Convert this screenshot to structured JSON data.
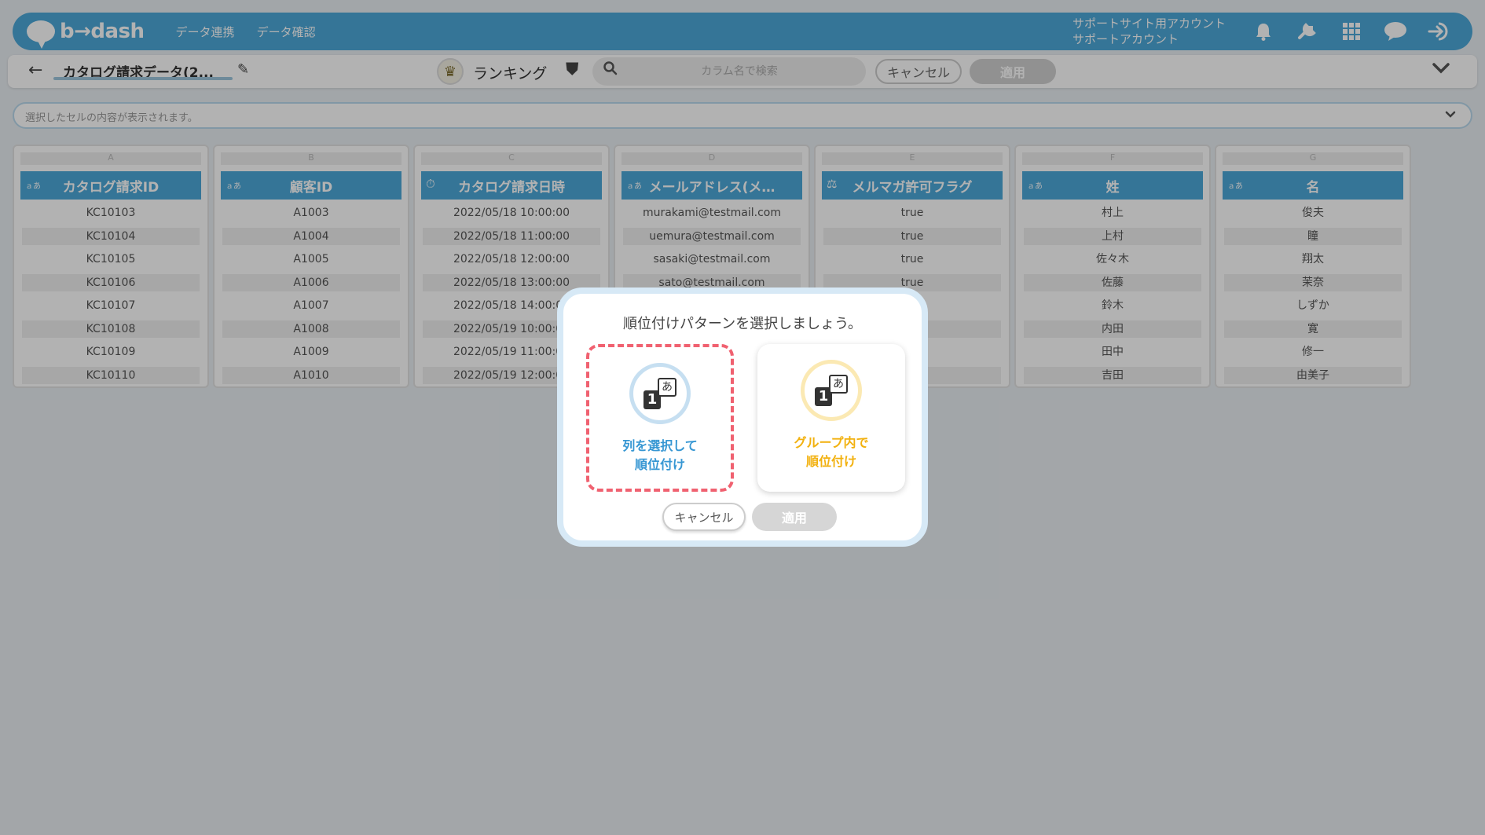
{
  "header": {
    "logo_text": "b→dash",
    "nav": [
      "データ連携",
      "データ確認"
    ],
    "account_line1": "サポートサイト用アカウント",
    "account_line2": "サポートアカウント",
    "icons": [
      "bell-icon",
      "wrench-icon",
      "grid-apps-icon",
      "chat-badge-icon",
      "logout-icon"
    ]
  },
  "toolbar": {
    "back_icon": "←",
    "table_title": "カタログ請求データ(2...",
    "edit_icon": "✎",
    "ranking_icon": "♛",
    "ranking_label": "ランキング",
    "shield_icon": "⛊",
    "search_placeholder": "カラム名で検索",
    "cancel_label": "キャンセル",
    "apply_label": "適用",
    "chevron": "⌄"
  },
  "cell_bar": {
    "placeholder": "選択したセルの内容が表示されます。",
    "chevron": "⌄"
  },
  "columns": [
    {
      "letter": "A",
      "type_icon": "ａあ",
      "header": "カタログ請求ID",
      "cells": [
        "KC10103",
        "KC10104",
        "KC10105",
        "KC10106",
        "KC10107",
        "KC10108",
        "KC10109",
        "KC10110"
      ]
    },
    {
      "letter": "B",
      "type_icon": "ａあ",
      "header": "顧客ID",
      "cells": [
        "A1003",
        "A1004",
        "A1005",
        "A1006",
        "A1007",
        "A1008",
        "A1009",
        "A1010"
      ]
    },
    {
      "letter": "C",
      "type_icon": "⏱",
      "header": "カタログ請求日時",
      "cells": [
        "2022/05/18 10:00:00",
        "2022/05/18 11:00:00",
        "2022/05/18 12:00:00",
        "2022/05/18 13:00:00",
        "2022/05/18 14:00:00",
        "2022/05/19 10:00:00",
        "2022/05/19 11:00:00",
        "2022/05/19 12:00:00"
      ]
    },
    {
      "letter": "D",
      "type_icon": "ａあ",
      "header": "メールアドレス(メ…",
      "cells": [
        "murakami@testmail.com",
        "uemura@testmail.com",
        "sasaki@testmail.com",
        "sato@testmail.com",
        "",
        "",
        "",
        ""
      ]
    },
    {
      "letter": "E",
      "type_icon": "⚖",
      "header": "メルマガ許可フラグ",
      "cells": [
        "true",
        "true",
        "true",
        "true",
        "",
        "",
        "",
        ""
      ]
    },
    {
      "letter": "F",
      "type_icon": "ａあ",
      "header": "姓",
      "cells": [
        "村上",
        "上村",
        "佐々木",
        "佐藤",
        "鈴木",
        "内田",
        "田中",
        "吉田"
      ]
    },
    {
      "letter": "G",
      "type_icon": "ａあ",
      "header": "名",
      "cells": [
        "俊夫",
        "瞳",
        "翔太",
        "茉奈",
        "しずか",
        "寛",
        "修一",
        "由美子"
      ]
    }
  ],
  "modal": {
    "title": "順位付けパターンを選択しましょう。",
    "option_glyph_number": "1",
    "option_glyph_kana": "あ",
    "option1_line1": "列を選択して",
    "option1_line2": "順位付け",
    "option2_line1": "グループ内で",
    "option2_line2": "順位付け",
    "cancel_label": "キャンセル",
    "apply_label": "適用"
  },
  "colors": {
    "brand_blue": "#4da8d8",
    "option1_accent": "#3797d3",
    "option2_accent": "#f2b10f",
    "selected_dash": "#f06170"
  }
}
